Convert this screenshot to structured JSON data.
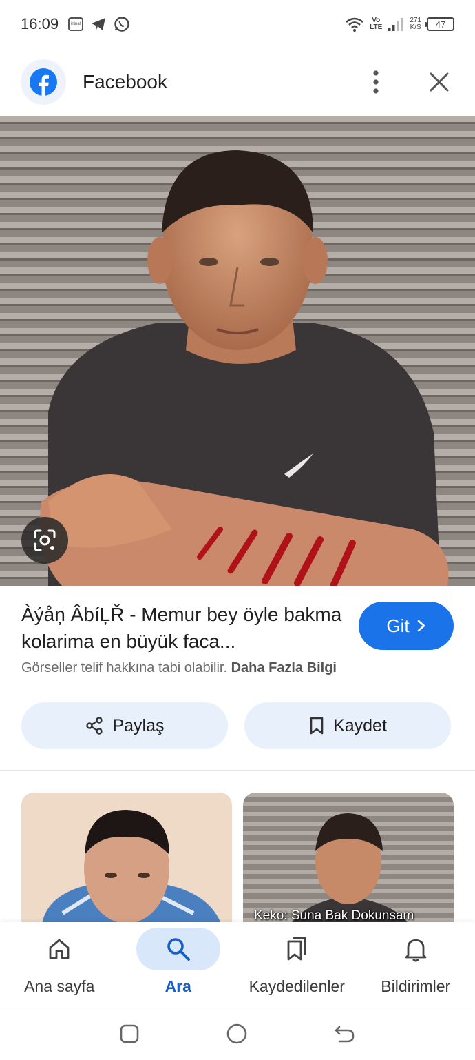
{
  "status_bar": {
    "time": "16:09",
    "volte_line1": "Vo",
    "volte_line2": "LTE",
    "speed_value": "271",
    "speed_unit": "K/S",
    "battery": "47",
    "icons": [
      "ininal-icon",
      "telegram-icon",
      "whatsapp-icon",
      "wifi-icon",
      "signal-icon"
    ]
  },
  "header": {
    "title": "Facebook",
    "icons": [
      "facebook-logo",
      "more-vert-icon",
      "close-icon"
    ]
  },
  "result": {
    "title": "Àýåņ ÂbíĻŘ - Memur bey öyle bakma kolarima en büyük faca...",
    "go_label": "Git",
    "copyright_text": "Görseller telif hakkına tabi olabilir.",
    "more_info_label": "Daha Fazla Bilgi"
  },
  "actions": {
    "share_label": "Paylaş",
    "save_label": "Kaydet"
  },
  "related": {
    "thumb2_caption": "Keko: Suna Bak Dokunsam"
  },
  "bottom_nav": {
    "items": [
      {
        "label": "Ana sayfa",
        "icon": "home-icon"
      },
      {
        "label": "Ara",
        "icon": "search-icon"
      },
      {
        "label": "Kaydedilenler",
        "icon": "collections-icon"
      },
      {
        "label": "Bildirimler",
        "icon": "bell-icon"
      }
    ],
    "active_index": 1
  },
  "system_nav": [
    "recent-apps-icon",
    "home-circle-icon",
    "back-icon"
  ],
  "colors": {
    "accent": "#1a73e8",
    "pill_bg": "#e8f0fc",
    "active_nav_bg": "#d9e7fb",
    "facebook_blue": "#1877f2"
  }
}
